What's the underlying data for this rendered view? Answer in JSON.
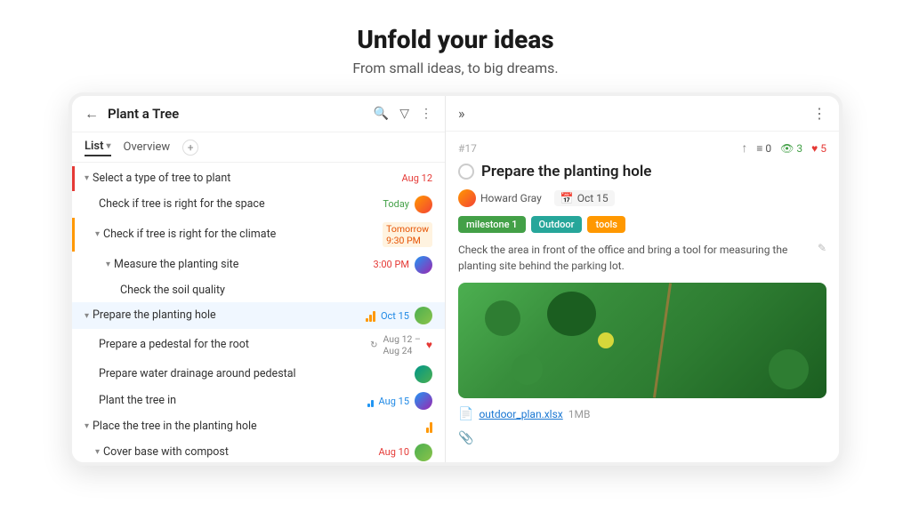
{
  "hero": {
    "title": "Unfold your ideas",
    "subtitle": "From small ideas, to big dreams."
  },
  "app": {
    "left": {
      "header": {
        "back_label": "←",
        "title": "Plant a Tree",
        "icons": [
          "search",
          "filter",
          "more"
        ]
      },
      "tabs": [
        {
          "label": "List",
          "active": true,
          "has_dropdown": true
        },
        {
          "label": "Overview",
          "active": false
        },
        {
          "label": "+",
          "is_add": true
        }
      ],
      "tasks": [
        {
          "id": 1,
          "indent": 0,
          "toggle": "▾",
          "name": "Select a type of tree to plant",
          "date": "Aug 12",
          "date_style": "red",
          "left_border": "red"
        },
        {
          "id": 2,
          "indent": 1,
          "toggle": "",
          "name": "Check if tree is right for the space",
          "date": "Today",
          "date_style": "green",
          "avatar": "orange"
        },
        {
          "id": 3,
          "indent": 1,
          "toggle": "▾",
          "name": "Check if tree is right for the climate",
          "date": "Tomorrow 9:30 PM",
          "date_style": "tomorrow",
          "left_border": "orange"
        },
        {
          "id": 4,
          "indent": 2,
          "toggle": "▾",
          "name": "Measure the planting site",
          "date": "3:00 PM",
          "date_style": "time-red",
          "avatar": "blue2"
        },
        {
          "id": 5,
          "indent": 3,
          "toggle": "",
          "name": "Check the soil quality",
          "date": "",
          "date_style": ""
        },
        {
          "id": 6,
          "indent": 0,
          "toggle": "▾",
          "name": "Prepare the planting hole",
          "date": "Oct 15",
          "date_style": "blue",
          "avatar": "green2",
          "highlighted": true,
          "priority_bars": [
            4,
            8,
            12
          ]
        },
        {
          "id": 7,
          "indent": 1,
          "toggle": "",
          "name": "Prepare a pedestal for the root",
          "date": "Aug 12 – Aug 24",
          "date_style": "normal",
          "heart": true,
          "sync": true
        },
        {
          "id": 8,
          "indent": 1,
          "toggle": "",
          "name": "Prepare water drainage around pedestal",
          "date": "",
          "date_style": "",
          "avatar": "teal"
        },
        {
          "id": 9,
          "indent": 1,
          "toggle": "",
          "name": "Plant the tree in",
          "date": "Aug 15",
          "date_style": "blue",
          "avatar": "blue2",
          "priority_bars": [
            4,
            8
          ]
        },
        {
          "id": 10,
          "indent": 0,
          "toggle": "▾",
          "name": "Place the tree in the planting hole",
          "date": "",
          "priority_bars": [
            6,
            12
          ]
        },
        {
          "id": 11,
          "indent": 1,
          "toggle": "▾",
          "name": "Cover base with compost",
          "date": "Aug 10",
          "date_style": "red",
          "avatar": "green2"
        }
      ]
    },
    "right": {
      "header": {
        "expand_label": "»",
        "more_label": "⋮"
      },
      "task_detail": {
        "number": "#17",
        "actions": {
          "up_arrow": "↑",
          "list_count": "0",
          "eye_count": "3",
          "heart_count": "5"
        },
        "title": "Prepare the planting hole",
        "assignee": "Howard Gray",
        "due_date": "Oct 15",
        "tags": [
          {
            "label": "milestone 1",
            "color": "green"
          },
          {
            "label": "Outdoor",
            "color": "teal"
          },
          {
            "label": "tools",
            "color": "orange"
          }
        ],
        "description": "Check the area in front of the office and bring a tool for measuring the planting site behind the parking lot.",
        "file": {
          "name": "outdoor_plan.xlsx",
          "size": "1MB"
        }
      }
    }
  }
}
